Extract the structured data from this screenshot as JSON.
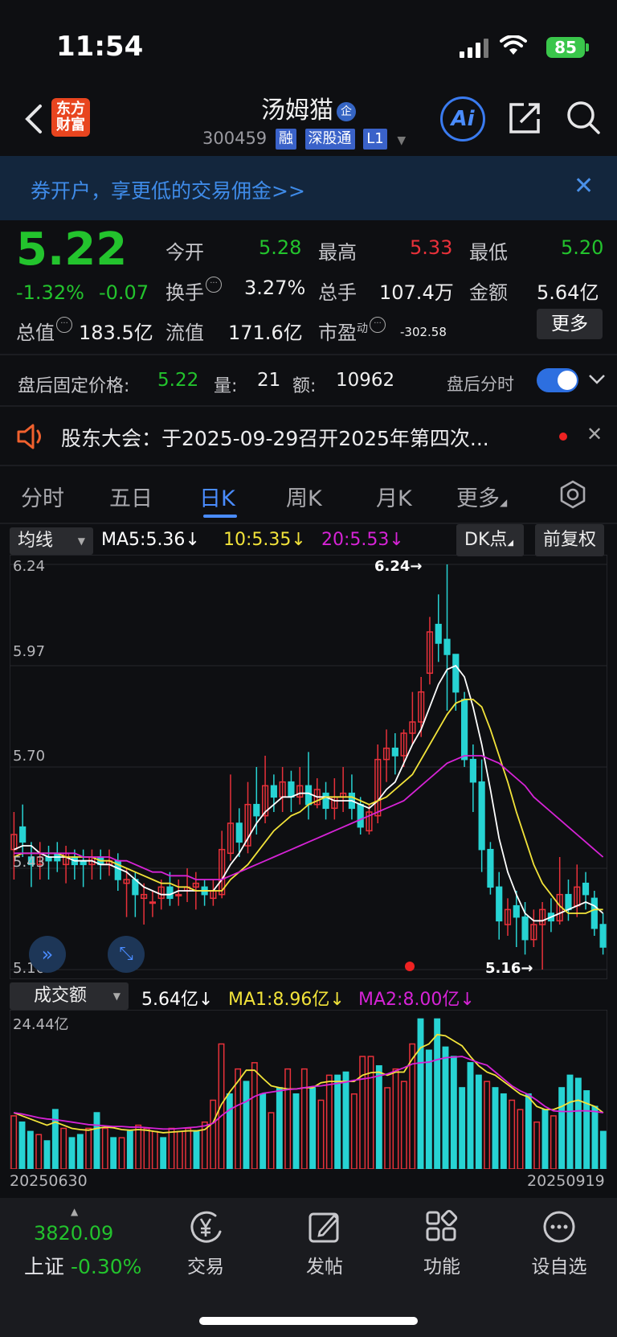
{
  "status": {
    "time": "11:54",
    "battery": "85"
  },
  "header": {
    "logo_line1": "东方",
    "logo_line2": "财富",
    "stock_name": "汤姆猫",
    "name_badge": "企",
    "code": "300459",
    "tags": [
      "融",
      "深股通",
      "L1"
    ],
    "ai_label": "Ai"
  },
  "banner": {
    "text": "券开户，享更低的交易佣金>>"
  },
  "quote": {
    "price": "5.22",
    "change_pct": "-1.32%",
    "change": "-0.07",
    "open_label": "今开",
    "open": "5.28",
    "high_label": "最高",
    "high": "5.33",
    "low_label": "最低",
    "low": "5.20",
    "turnover_label": "换手",
    "turnover": "3.27%",
    "volume_label": "总手",
    "volume": "107.4万",
    "amount_label": "金额",
    "amount": "5.64亿",
    "mcap_label": "总值",
    "mcap": "183.5亿",
    "float_label": "流值",
    "float": "171.6亿",
    "pe_label": "市盈",
    "pe_sup": "动",
    "pe": "-302.58",
    "more": "更多"
  },
  "after_hours": {
    "label": "盘后固定价格:",
    "price": "5.22",
    "qty_label": "量:",
    "qty": "21",
    "amt_label": "额:",
    "amt": "10962",
    "timeshare_label": "盘后分时"
  },
  "notice": {
    "text": "股东大会：于2025-09-29召开2025年第四次..."
  },
  "tabs": [
    {
      "label": "分时"
    },
    {
      "label": "五日"
    },
    {
      "label": "日K"
    },
    {
      "label": "周K"
    },
    {
      "label": "月K"
    },
    {
      "label": "更多"
    }
  ],
  "ma_bar": {
    "selector": "均线",
    "ma5": "MA5:5.36",
    "ma10": "10:5.35",
    "ma20": "20:5.53",
    "dk": "DK点",
    "adjust": "前复权"
  },
  "vol_bar": {
    "selector": "成交额",
    "value": "5.64亿",
    "ma1": "MA1:8.96亿",
    "ma2": "MA2:8.00亿"
  },
  "colors": {
    "up": "#e8313a",
    "down": "#27d3d3",
    "ma5": "#ffffff",
    "ma10": "#f2e33a",
    "ma20": "#d623d6",
    "green": "#23c32d"
  },
  "chart_data": [
    {
      "type": "candlestick",
      "y_ticks": [
        "6.24",
        "5.97",
        "5.70",
        "5.43",
        "5.16"
      ],
      "ylim": [
        5.16,
        6.24
      ],
      "max_label": "6.24→",
      "min_label": "5.16→",
      "x_start": "20250630",
      "x_end": "20250919",
      "candles": [
        [
          5.48,
          5.52,
          5.4,
          5.58
        ],
        [
          5.54,
          5.5,
          5.46,
          5.6
        ],
        [
          5.46,
          5.44,
          5.38,
          5.5
        ],
        [
          5.44,
          5.46,
          5.4,
          5.5
        ],
        [
          5.46,
          5.45,
          5.4,
          5.49
        ],
        [
          5.47,
          5.45,
          5.42,
          5.5
        ],
        [
          5.44,
          5.47,
          5.39,
          5.49
        ],
        [
          5.46,
          5.44,
          5.4,
          5.48
        ],
        [
          5.45,
          5.44,
          5.38,
          5.48
        ],
        [
          5.44,
          5.46,
          5.4,
          5.48
        ],
        [
          5.46,
          5.44,
          5.4,
          5.48
        ],
        [
          5.44,
          5.45,
          5.41,
          5.48
        ],
        [
          5.45,
          5.4,
          5.37,
          5.47
        ],
        [
          5.39,
          5.4,
          5.3,
          5.43
        ],
        [
          5.4,
          5.36,
          5.3,
          5.42
        ],
        [
          5.35,
          5.36,
          5.28,
          5.39
        ],
        [
          5.34,
          5.34,
          5.3,
          5.37
        ],
        [
          5.35,
          5.38,
          5.32,
          5.4
        ],
        [
          5.38,
          5.35,
          5.33,
          5.42
        ],
        [
          5.36,
          5.36,
          5.33,
          5.4
        ],
        [
          5.37,
          5.38,
          5.34,
          5.43
        ],
        [
          5.38,
          5.39,
          5.32,
          5.42
        ],
        [
          5.38,
          5.36,
          5.33,
          5.4
        ],
        [
          5.35,
          5.37,
          5.33,
          5.4
        ],
        [
          5.36,
          5.48,
          5.35,
          5.53
        ],
        [
          5.47,
          5.55,
          5.45,
          5.68
        ],
        [
          5.55,
          5.5,
          5.46,
          5.59
        ],
        [
          5.49,
          5.6,
          5.47,
          5.66
        ],
        [
          5.6,
          5.57,
          5.52,
          5.7
        ],
        [
          5.57,
          5.65,
          5.55,
          5.73
        ],
        [
          5.65,
          5.62,
          5.58,
          5.68
        ],
        [
          5.62,
          5.66,
          5.58,
          5.7
        ],
        [
          5.66,
          5.62,
          5.58,
          5.69
        ],
        [
          5.62,
          5.65,
          5.6,
          5.7
        ],
        [
          5.65,
          5.6,
          5.56,
          5.74
        ],
        [
          5.6,
          5.64,
          5.59,
          5.67
        ],
        [
          5.63,
          5.59,
          5.56,
          5.66
        ],
        [
          5.59,
          5.62,
          5.56,
          5.67
        ],
        [
          5.62,
          5.63,
          5.58,
          5.7
        ],
        [
          5.63,
          5.59,
          5.56,
          5.68
        ],
        [
          5.6,
          5.54,
          5.52,
          5.62
        ],
        [
          5.53,
          5.58,
          5.52,
          5.6
        ],
        [
          5.57,
          5.72,
          5.55,
          5.76
        ],
        [
          5.72,
          5.75,
          5.66,
          5.8
        ],
        [
          5.75,
          5.73,
          5.68,
          5.79
        ],
        [
          5.73,
          5.79,
          5.7,
          5.8
        ],
        [
          5.79,
          5.82,
          5.76,
          5.9
        ],
        [
          5.82,
          5.9,
          5.78,
          5.94
        ],
        [
          5.95,
          6.06,
          5.92,
          6.1
        ],
        [
          6.08,
          6.03,
          5.98,
          6.16
        ],
        [
          6.04,
          6.0,
          5.85,
          6.24
        ],
        [
          6.0,
          5.9,
          5.85,
          5.98
        ],
        [
          5.88,
          5.72,
          5.7,
          5.9
        ],
        [
          5.72,
          5.66,
          5.58,
          5.76
        ],
        [
          5.66,
          5.48,
          5.42,
          5.72
        ],
        [
          5.48,
          5.38,
          5.36,
          5.5
        ],
        [
          5.38,
          5.29,
          5.24,
          5.42
        ],
        [
          5.28,
          5.32,
          5.25,
          5.35
        ],
        [
          5.33,
          5.3,
          5.22,
          5.37
        ],
        [
          5.3,
          5.24,
          5.2,
          5.34
        ],
        [
          5.24,
          5.28,
          5.22,
          5.32
        ],
        [
          5.28,
          5.32,
          5.16,
          5.34
        ],
        [
          5.31,
          5.29,
          5.26,
          5.35
        ],
        [
          5.29,
          5.36,
          5.28,
          5.46
        ],
        [
          5.36,
          5.32,
          5.29,
          5.4
        ],
        [
          5.33,
          5.38,
          5.3,
          5.44
        ],
        [
          5.39,
          5.36,
          5.32,
          5.42
        ],
        [
          5.35,
          5.27,
          5.25,
          5.37
        ],
        [
          5.28,
          5.22,
          5.2,
          5.31
        ]
      ],
      "ma5": [
        5.48,
        5.49,
        5.49,
        5.47,
        5.46,
        5.46,
        5.46,
        5.45,
        5.45,
        5.45,
        5.44,
        5.44,
        5.43,
        5.42,
        5.4,
        5.38,
        5.37,
        5.36,
        5.36,
        5.37,
        5.37,
        5.37,
        5.37,
        5.37,
        5.4,
        5.44,
        5.47,
        5.51,
        5.55,
        5.58,
        5.6,
        5.62,
        5.62,
        5.63,
        5.63,
        5.62,
        5.62,
        5.61,
        5.61,
        5.61,
        5.6,
        5.59,
        5.61,
        5.64,
        5.66,
        5.71,
        5.76,
        5.8,
        5.86,
        5.92,
        5.96,
        5.97,
        5.94,
        5.86,
        5.76,
        5.64,
        5.51,
        5.42,
        5.36,
        5.31,
        5.29,
        5.29,
        5.3,
        5.31,
        5.32,
        5.33,
        5.34,
        5.33,
        5.31
      ],
      "ma10": [
        5.46,
        5.47,
        5.47,
        5.47,
        5.47,
        5.47,
        5.46,
        5.46,
        5.46,
        5.46,
        5.45,
        5.45,
        5.44,
        5.43,
        5.42,
        5.41,
        5.4,
        5.39,
        5.39,
        5.38,
        5.38,
        5.37,
        5.37,
        5.37,
        5.37,
        5.4,
        5.42,
        5.44,
        5.47,
        5.5,
        5.53,
        5.55,
        5.57,
        5.58,
        5.6,
        5.61,
        5.62,
        5.62,
        5.62,
        5.62,
        5.61,
        5.6,
        5.61,
        5.62,
        5.64,
        5.66,
        5.68,
        5.72,
        5.76,
        5.8,
        5.84,
        5.87,
        5.88,
        5.88,
        5.86,
        5.8,
        5.73,
        5.66,
        5.58,
        5.51,
        5.44,
        5.39,
        5.36,
        5.33,
        5.31,
        5.31,
        5.31,
        5.32,
        5.32
      ],
      "ma20": [
        5.47,
        5.47,
        5.47,
        5.47,
        5.47,
        5.47,
        5.47,
        5.47,
        5.46,
        5.46,
        5.46,
        5.46,
        5.45,
        5.45,
        5.44,
        5.43,
        5.42,
        5.42,
        5.41,
        5.41,
        5.41,
        5.4,
        5.4,
        5.4,
        5.4,
        5.41,
        5.42,
        5.43,
        5.44,
        5.45,
        5.46,
        5.47,
        5.48,
        5.49,
        5.5,
        5.51,
        5.52,
        5.53,
        5.54,
        5.55,
        5.56,
        5.57,
        5.58,
        5.59,
        5.6,
        5.61,
        5.63,
        5.65,
        5.67,
        5.69,
        5.71,
        5.72,
        5.73,
        5.73,
        5.73,
        5.72,
        5.71,
        5.69,
        5.67,
        5.65,
        5.62,
        5.6,
        5.58,
        5.56,
        5.54,
        5.52,
        5.5,
        5.48,
        5.46
      ]
    },
    {
      "type": "bar",
      "y_max_label": "24.44亿",
      "ylim": [
        0,
        24.44
      ],
      "values": [
        8.5,
        7.5,
        6.0,
        5.5,
        4.5,
        9.5,
        6.5,
        5.0,
        5.5,
        6.5,
        9.0,
        6.5,
        5.0,
        5.0,
        6.0,
        7.0,
        6.5,
        6.0,
        5.0,
        6.5,
        6.0,
        6.5,
        6.0,
        7.5,
        11.0,
        20.0,
        12.0,
        16.0,
        14.0,
        17.0,
        12.0,
        9.0,
        13.0,
        16.0,
        12.0,
        16.0,
        13.0,
        11.0,
        15.0,
        15.0,
        15.5,
        12.0,
        18.0,
        18.0,
        16.5,
        13.0,
        16.0,
        14.0,
        20.0,
        24.0,
        19.0,
        24.0,
        19.5,
        18.0,
        13.0,
        17.0,
        15.0,
        14.0,
        13.0,
        12.0,
        11.0,
        9.5,
        12.0,
        7.5,
        9.5,
        8.5,
        13.0,
        15.0,
        14.5,
        12.5,
        10.0,
        6.0
      ],
      "ma1": [
        9.0,
        8.5,
        8.0,
        7.5,
        7.0,
        7.5,
        7.0,
        6.5,
        6.3,
        6.2,
        6.5,
        6.7,
        6.6,
        6.3,
        6.2,
        6.3,
        6.2,
        6.0,
        5.8,
        5.9,
        6.0,
        6.1,
        6.1,
        6.3,
        7.4,
        10.3,
        12.3,
        14.0,
        15.8,
        15.8,
        14.5,
        13.3,
        13.0,
        12.8,
        12.8,
        13.0,
        13.0,
        13.8,
        14.0,
        14.0,
        14.0,
        14.0,
        15.0,
        15.4,
        15.5,
        15.0,
        15.5,
        15.5,
        17.6,
        19.4,
        20.0,
        21.5,
        21.3,
        20.5,
        19.7,
        18.0,
        16.5,
        15.5,
        15.0,
        14.0,
        13.0,
        12.0,
        11.5,
        10.0,
        9.5,
        9.5,
        10.0,
        10.7,
        11.0,
        10.5,
        10.0,
        9.0
      ],
      "ma2": [
        9.0,
        8.8,
        8.5,
        8.2,
        8.0,
        7.9,
        7.7,
        7.5,
        7.3,
        7.1,
        7.0,
        6.9,
        6.8,
        6.8,
        6.7,
        6.7,
        6.6,
        6.5,
        6.4,
        6.4,
        6.5,
        6.6,
        6.7,
        6.9,
        7.3,
        8.5,
        9.5,
        10.2,
        10.8,
        11.6,
        12.1,
        12.3,
        12.5,
        12.7,
        12.8,
        13.0,
        13.2,
        13.3,
        13.5,
        13.7,
        13.9,
        14.2,
        14.4,
        14.6,
        14.9,
        15.2,
        15.7,
        16.2,
        16.8,
        17.0,
        17.1,
        17.5,
        17.8,
        17.9,
        18.0,
        17.5,
        17.0,
        16.6,
        15.5,
        14.4,
        13.3,
        12.5,
        11.9,
        11.0,
        10.0,
        9.3,
        9.2,
        9.2,
        9.3,
        9.3,
        9.2,
        9.0
      ]
    }
  ],
  "bottom_bar": {
    "index_value": "3820.09",
    "index_name": "上证",
    "index_change": "-0.30%",
    "items": [
      {
        "label": "交易"
      },
      {
        "label": "发帖"
      },
      {
        "label": "功能"
      },
      {
        "label": "设自选"
      }
    ]
  }
}
